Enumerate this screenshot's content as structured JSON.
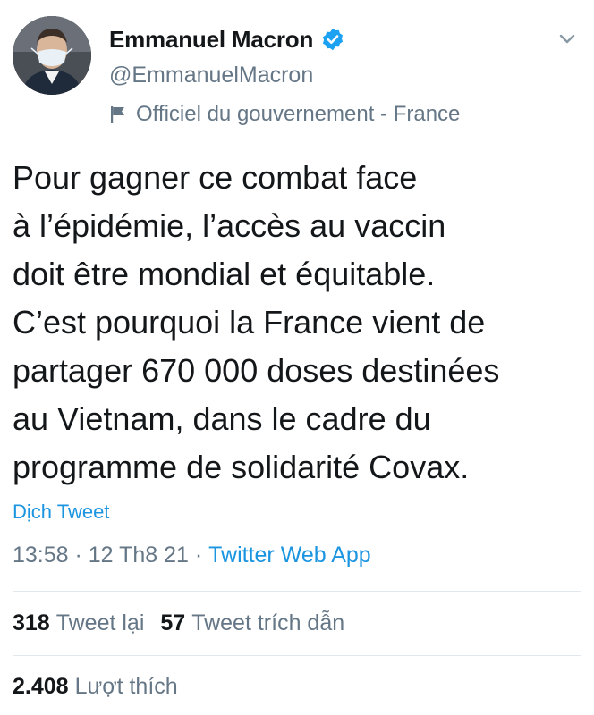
{
  "user": {
    "display_name": "Emmanuel Macron",
    "handle": "@EmmanuelMacron",
    "label": "Officiel du gouvernement - France",
    "verified": true
  },
  "tweet": {
    "lines": [
      "Pour gagner ce combat face",
      "à l’épidémie, l’accès au vaccin",
      "doit être mondial et équitable.",
      "C’est pourquoi la France vient de",
      "partager 670 000 doses destinées",
      "au Vietnam, dans le cadre du",
      "programme de solidarité Covax."
    ],
    "translate_label": "Dịch Tweet",
    "time": "13:58",
    "separator": " · ",
    "date": "12 Th8 21",
    "source": "Twitter Web App"
  },
  "stats": {
    "retweets_count": "318",
    "retweets_label": "Tweet lại",
    "quotes_count": "57",
    "quotes_label": "Tweet trích dẫn",
    "likes_count": "2.408",
    "likes_label": "Lượt thích"
  },
  "colors": {
    "link": "#1b95e0",
    "secondary_text": "#657786",
    "primary_text": "#14171a",
    "verified_badge": "#1da1f2",
    "divider": "#e1e8ed"
  },
  "icons": {
    "verified": "verified-badge-icon",
    "label": "flag-icon",
    "menu": "chevron-down-icon"
  }
}
